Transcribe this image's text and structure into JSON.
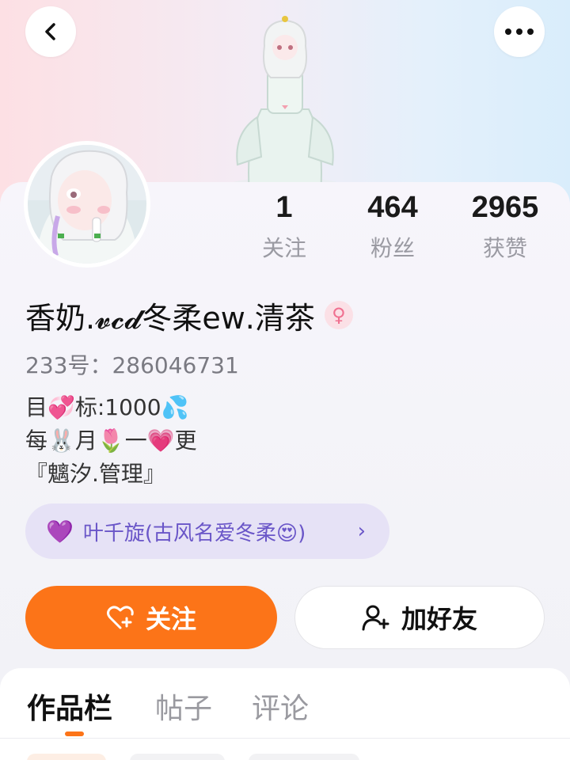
{
  "header": {
    "back_icon": "chevron-left-icon",
    "more_icon": "more-horizontal-icon"
  },
  "stats": [
    {
      "value": "1",
      "label": "关注"
    },
    {
      "value": "464",
      "label": "粉丝"
    },
    {
      "value": "2965",
      "label": "获赞"
    }
  ],
  "profile": {
    "name": "香奶.𝓿𝓬𝓭冬柔eᴡ.清茶",
    "gender_symbol": "♀",
    "uid": "233号：286046731",
    "bio_lines": [
      "目💞标:1000💦",
      "每🐰月🌷一💗更",
      "『魑汐.管理』"
    ]
  },
  "tag_chip": {
    "icon": "💜",
    "label": "叶千旋(古风名爱冬柔😍)",
    "chevron": "›"
  },
  "actions": {
    "follow_label": "关注",
    "add_friend_label": "加好友"
  },
  "tabs": [
    "作品栏",
    "帖子",
    "评论"
  ],
  "colors": {
    "accent": "#fc7418",
    "chip_bg": "#e6e2f6",
    "chip_text": "#6a56c8"
  }
}
